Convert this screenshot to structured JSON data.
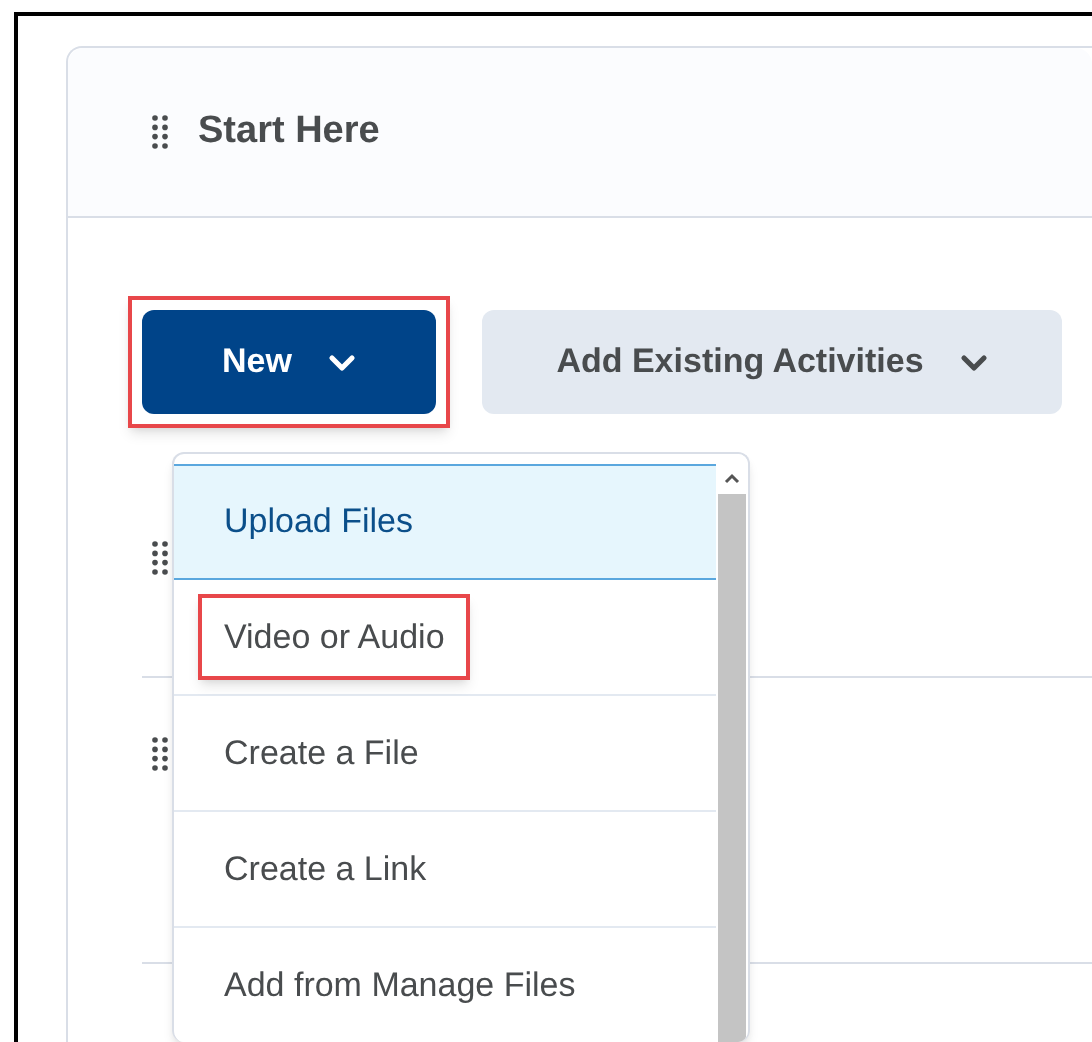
{
  "section": {
    "title": "Start Here"
  },
  "buttons": [
    {
      "label": "New",
      "kind": "primary",
      "highlighted": true
    },
    {
      "label": "Add Existing Activities",
      "kind": "secondary",
      "highlighted": false
    }
  ],
  "menu": {
    "items": [
      {
        "label": "Upload Files",
        "selected": true,
        "highlighted": false
      },
      {
        "label": "Video or Audio",
        "selected": false,
        "highlighted": true
      },
      {
        "label": "Create a File",
        "selected": false,
        "highlighted": false
      },
      {
        "label": "Create a Link",
        "selected": false,
        "highlighted": false
      },
      {
        "label": "Add from Manage Files",
        "selected": false,
        "highlighted": false
      }
    ]
  }
}
